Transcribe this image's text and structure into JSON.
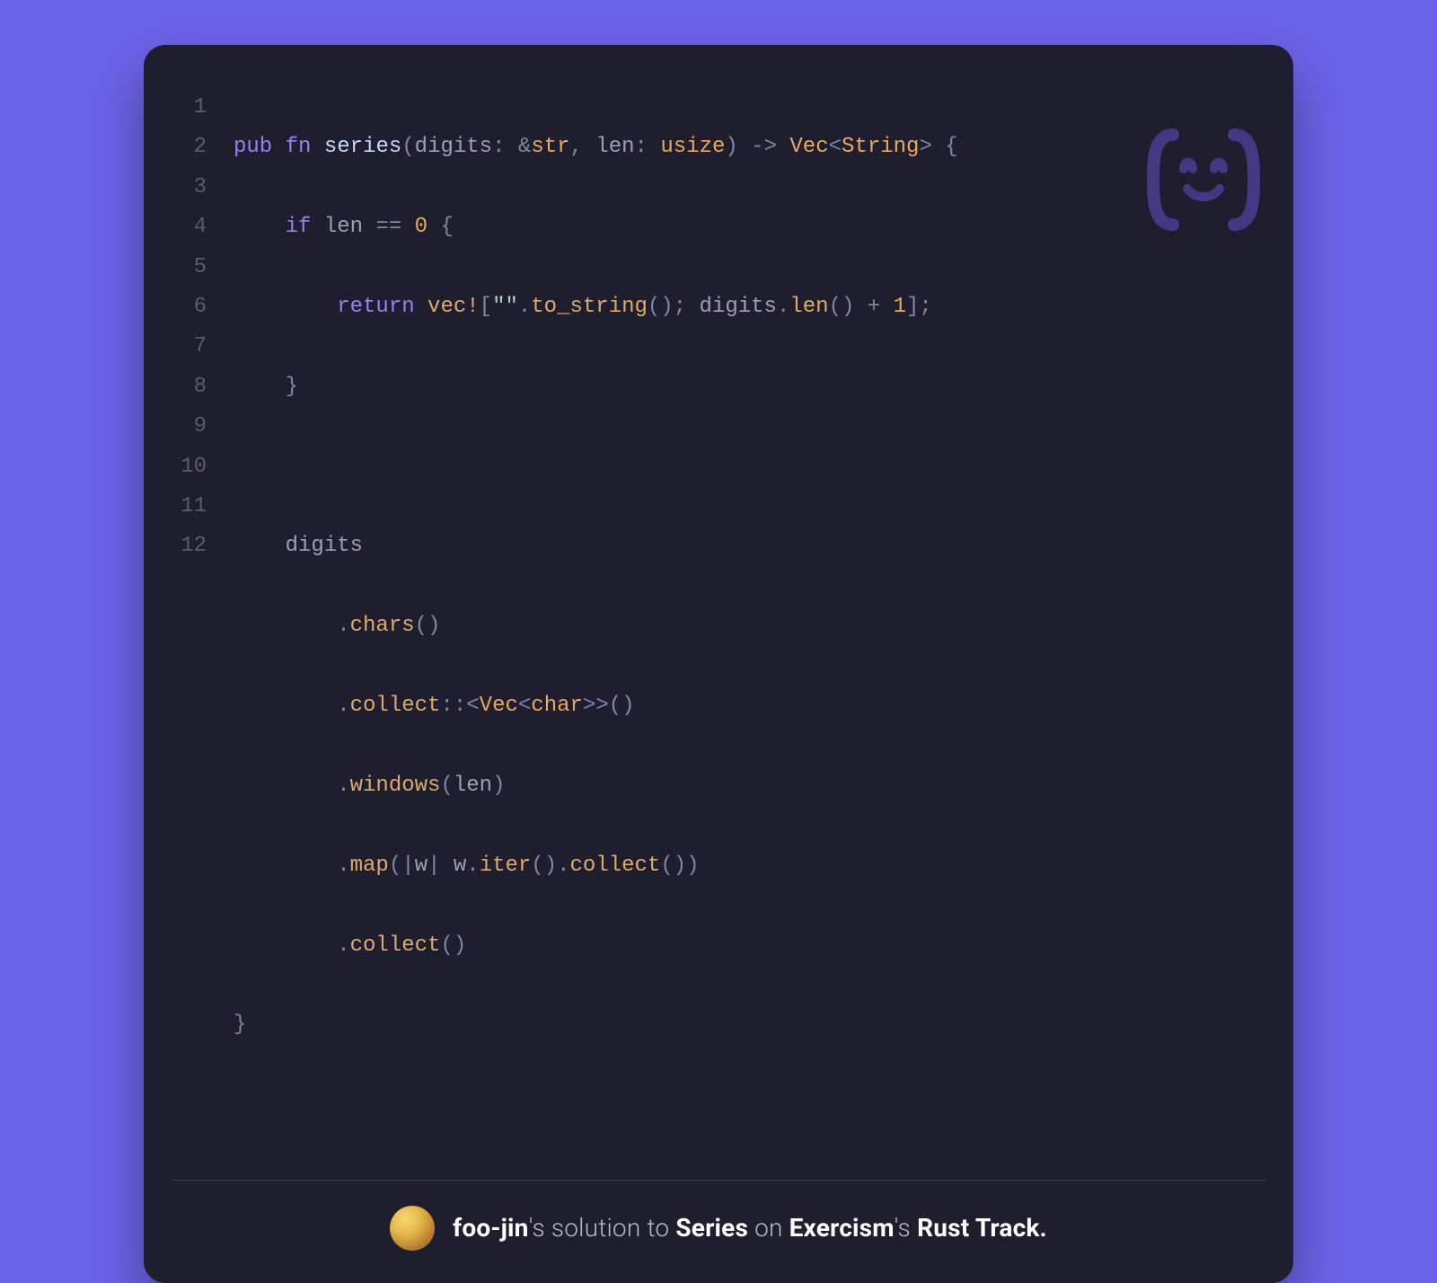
{
  "code": {
    "lineNumbers": [
      "1",
      "2",
      "3",
      "4",
      "5",
      "6",
      "7",
      "8",
      "9",
      "10",
      "11",
      "12"
    ],
    "lines": {
      "l1": {
        "pub": "pub",
        "fn": "fn",
        "name": "series",
        "op1": "(",
        "p1": "digits",
        "c1": ":",
        "amp": " &",
        "t1": "str",
        "c2": ",",
        "p2": " len",
        "c3": ":",
        "t2": " usize",
        "op2": ")",
        "arrow": " -> ",
        "t3": "Vec",
        "lt": "<",
        "t4": "String",
        "gt": ">",
        "brace": " {"
      },
      "l2": {
        "indent": "    ",
        "if": "if",
        "sp": " ",
        "id": "len",
        "eq": " == ",
        "zero": "0",
        "brace": " {"
      },
      "l3": {
        "indent": "        ",
        "ret": "return",
        "sp": " ",
        "vec": "vec!",
        "lb": "[",
        "q": "\"\"",
        "dot": ".",
        "ts": "to_string",
        "pp": "(); ",
        "dig": "digits",
        "dot2": ".",
        "len": "len",
        "pp2": "()",
        "plus": " + ",
        "one": "1",
        "rb": "];"
      },
      "l4": {
        "indent": "    ",
        "brace": "}"
      },
      "l5": {
        "blank": ""
      },
      "l6": {
        "indent": "    ",
        "id": "digits"
      },
      "l7": {
        "indent": "        ",
        "dot": ".",
        "fn": "chars",
        "pp": "()"
      },
      "l8": {
        "indent": "        ",
        "dot": ".",
        "fn": "collect",
        "cc": "::",
        "lt": "<",
        "t1": "Vec",
        "lt2": "<",
        "t2": "char",
        "gt2": ">",
        "gt": ">",
        "pp": "()"
      },
      "l9": {
        "indent": "        ",
        "dot": ".",
        "fn": "windows",
        "lp": "(",
        "id": "len",
        "rp": ")"
      },
      "l10": {
        "indent": "        ",
        "dot": ".",
        "fn": "map",
        "lp": "(",
        "pipe": "|",
        "w": "w",
        "pipe2": "| ",
        "w2": "w",
        "dot2": ".",
        "iter": "iter",
        "pp": "()",
        "dot3": ".",
        "coll": "collect",
        "pp2": "())"
      },
      "l11": {
        "indent": "        ",
        "dot": ".",
        "fn": "collect",
        "pp": "()"
      },
      "l12": {
        "brace": "}"
      }
    }
  },
  "footer": {
    "user": "foo-jin",
    "posUser": "'s",
    "solutionTo": " solution to ",
    "exercise": "Series",
    "on": " on ",
    "site": "Exercism",
    "posSite": "'s",
    "track": " Rust Track."
  }
}
